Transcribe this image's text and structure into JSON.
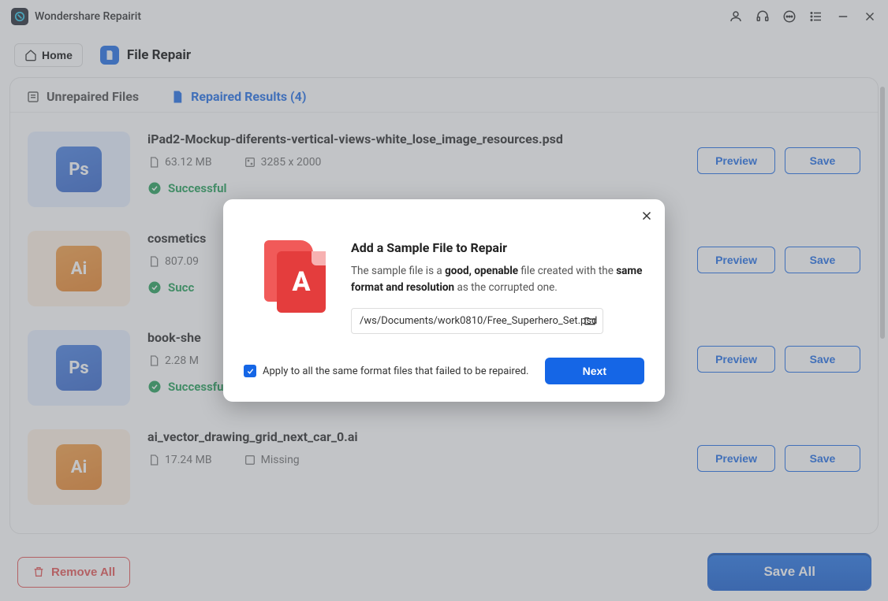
{
  "app": {
    "title": "Wondershare Repairit"
  },
  "toolbar": {
    "home": "Home",
    "page_title": "File Repair"
  },
  "tabs": {
    "unrepaired": "Unrepaired Files",
    "repaired": "Repaired Results (4)"
  },
  "files": [
    {
      "name": "iPad2-Mockup-diferents-vertical-views-white_lose_image_resources.psd",
      "type": "ps",
      "badge": "Ps",
      "size": "63.12 MB",
      "dims": "3285 x 2000",
      "status": "Successful",
      "preview": "Preview",
      "save": "Save"
    },
    {
      "name": "cosmetics",
      "type": "ai",
      "badge": "Ai",
      "size": "807.09",
      "dims": "",
      "status": "Succ",
      "preview": "Preview",
      "save": "Save"
    },
    {
      "name": "book-she",
      "type": "ps",
      "badge": "Ps",
      "size": "2.28 M",
      "dims": "",
      "status": "Successful",
      "preview": "Preview",
      "save": "Save"
    },
    {
      "name": "ai_vector_drawing_grid_next_car_0.ai",
      "type": "ai",
      "badge": "Ai",
      "size": "17.24 MB",
      "dims": "Missing",
      "status": "",
      "preview": "Preview",
      "save": "Save"
    }
  ],
  "footer": {
    "remove_all": "Remove All",
    "save_all": "Save All"
  },
  "modal": {
    "title": "Add a Sample File to Repair",
    "desc_1": "The sample file is a ",
    "desc_b1": "good, openable",
    "desc_2": " file created with the ",
    "desc_b2": "same format and resolution",
    "desc_3": " as the corrupted one.",
    "path": "/ws/Documents/work0810/Free_Superhero_Set.psd",
    "apply_label": "Apply to all the same format files that failed to be repaired.",
    "next": "Next"
  }
}
